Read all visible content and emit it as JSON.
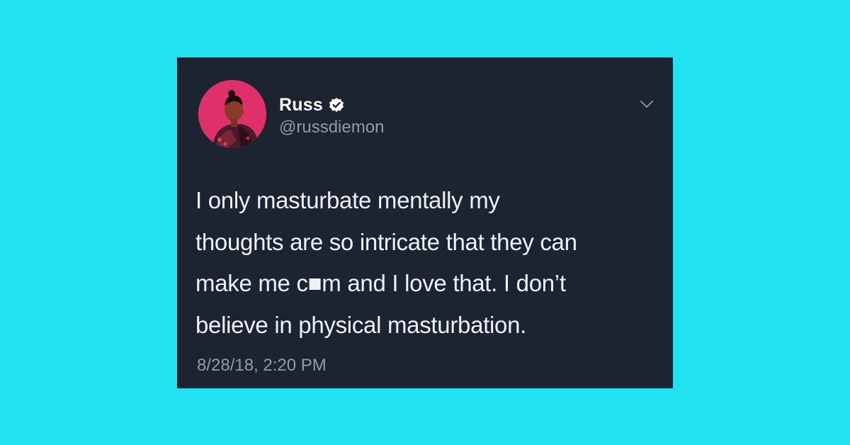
{
  "tweet": {
    "author_name": "Russ",
    "verified": true,
    "handle": "@russdiemon",
    "text_lines": [
      "I only masturbate mentally my",
      "thoughts are so intricate that they can",
      "make me c■m and I love that. I don’t",
      "believe in physical masturbation."
    ],
    "timestamp": "8/28/18, 2:20 PM"
  },
  "icons": {
    "verified": "verified-badge-icon",
    "menu": "chevron-down-icon"
  },
  "colors": {
    "page_background": "#22e1f1",
    "card_background": "#1c2431",
    "primary_text": "#ffffff",
    "secondary_text": "#8f9bab",
    "avatar_background": "#e0306a"
  }
}
